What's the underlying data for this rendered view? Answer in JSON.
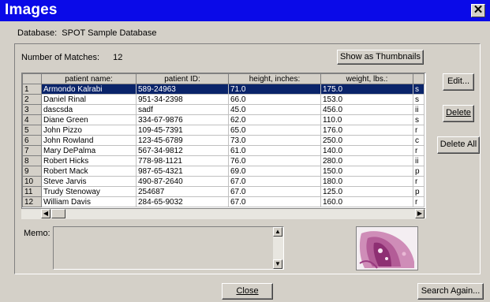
{
  "window": {
    "title": "Images",
    "close_glyph": "✕"
  },
  "database": {
    "label": "Database:",
    "value": "SPOT Sample Database"
  },
  "matches": {
    "label": "Number of Matches:",
    "value": "12"
  },
  "buttons": {
    "show_thumbnails": "Show as Thumbnails",
    "edit": "Edit...",
    "delete": "Delete",
    "delete_all": "Delete All",
    "close": "Close",
    "search_again": "Search Again..."
  },
  "grid": {
    "columns": [
      "patient name:",
      "patient ID:",
      "height, inches:",
      "weight, lbs.:"
    ],
    "rows": [
      {
        "n": "1",
        "name": "Armondo Kalrabi",
        "id": "589-24963",
        "height": "71.0",
        "weight": "175.0",
        "extra": "s"
      },
      {
        "n": "2",
        "name": "Daniel Rinal",
        "id": "951-34-2398",
        "height": "66.0",
        "weight": "153.0",
        "extra": "s"
      },
      {
        "n": "3",
        "name": "dascsda",
        "id": "sadf",
        "height": "45.0",
        "weight": "456.0",
        "extra": "ii"
      },
      {
        "n": "4",
        "name": "Diane Green",
        "id": "334-67-9876",
        "height": "62.0",
        "weight": "110.0",
        "extra": "s"
      },
      {
        "n": "5",
        "name": "John Pizzo",
        "id": "109-45-7391",
        "height": "65.0",
        "weight": "176.0",
        "extra": "r"
      },
      {
        "n": "6",
        "name": "John Rowland",
        "id": "123-45-6789",
        "height": "73.0",
        "weight": "250.0",
        "extra": "c"
      },
      {
        "n": "7",
        "name": "Mary DePalma",
        "id": "567-34-9812",
        "height": "61.0",
        "weight": "140.0",
        "extra": "r"
      },
      {
        "n": "8",
        "name": "Robert Hicks",
        "id": "778-98-1121",
        "height": "76.0",
        "weight": "280.0",
        "extra": "ii"
      },
      {
        "n": "9",
        "name": "Robert Mack",
        "id": "987-65-4321",
        "height": "69.0",
        "weight": "150.0",
        "extra": "p"
      },
      {
        "n": "10",
        "name": "Steve Jarvis",
        "id": "490-87-2640",
        "height": "67.0",
        "weight": "180.0",
        "extra": "r"
      },
      {
        "n": "11",
        "name": "Trudy Stenoway",
        "id": "254687",
        "height": "67.0",
        "weight": "125.0",
        "extra": "p"
      },
      {
        "n": "12",
        "name": "William Davis",
        "id": "284-65-9032",
        "height": "67.0",
        "weight": "160.0",
        "extra": "r"
      }
    ],
    "selected_row": 1
  },
  "memo": {
    "label": "Memo:",
    "value": ""
  },
  "colors": {
    "titlebar": "#0a0ae8",
    "selection": "#0a246a",
    "face": "#d4d0c8"
  }
}
